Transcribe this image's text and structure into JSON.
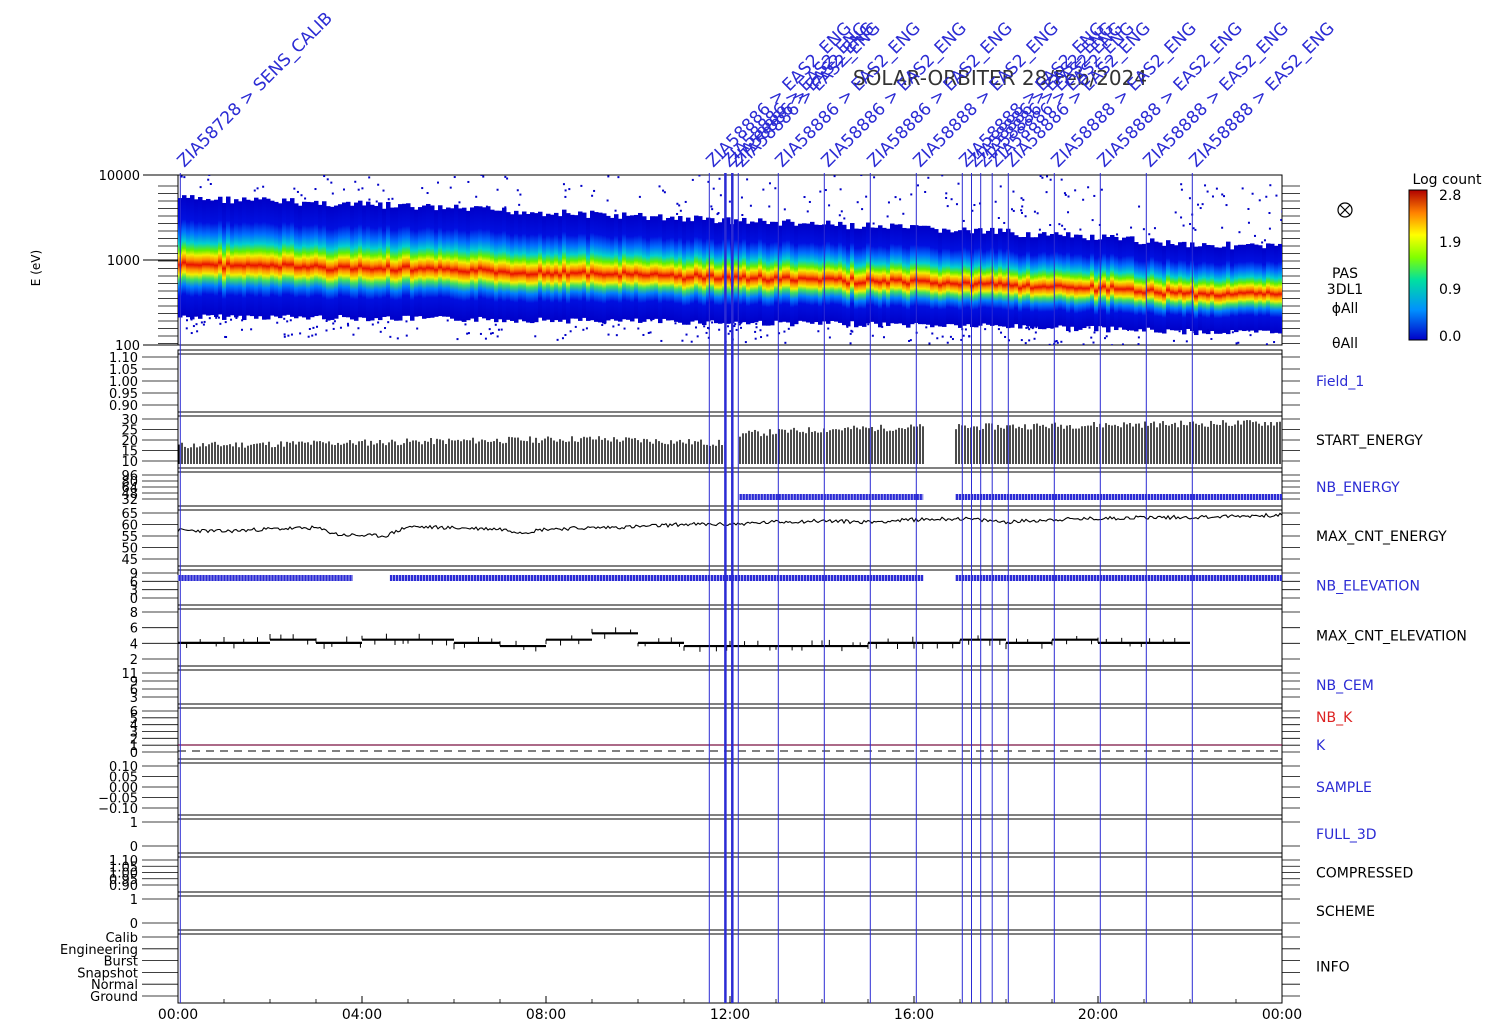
{
  "chart_data": {
    "type": "line",
    "title": "SOLAR-ORBITER 28/Feb/2024",
    "x_ticks": [
      "00:00",
      "04:00",
      "08:00",
      "12:00",
      "16:00",
      "20:00",
      "00:00"
    ],
    "x_range_hours": [
      0,
      24
    ],
    "colors": {
      "markers": "#2b2bd4",
      "black_series": "#000000",
      "nb_k": "#dd2222",
      "k_line": "#7a1040"
    },
    "markers": [
      {
        "hour": 0.05,
        "label": "ZIA58728 > SENS_CALIB"
      },
      {
        "hour": 11.55,
        "label": "ZIA58886 > EAS2_ENG"
      },
      {
        "hour": 11.9,
        "label": "ZIA58886 > EAS2_ENG"
      },
      {
        "hour": 12.05,
        "label": "ZIA58886 > EAS2_ENG"
      },
      {
        "hour": 12.18,
        "label": "ZIA58886 > EAS2_ENG"
      },
      {
        "hour": 13.05,
        "label": "ZIA58886 > EAS2_ENG"
      },
      {
        "hour": 14.05,
        "label": "ZIA58886 > EAS2_ENG"
      },
      {
        "hour": 15.05,
        "label": "ZIA58886 > EAS2_ENG"
      },
      {
        "hour": 16.05,
        "label": "ZIA58888 > EAS2_ENG"
      },
      {
        "hour": 17.05,
        "label": "ZIA58888 > EAS2_ENG"
      },
      {
        "hour": 17.25,
        "label": "ZIA58886 > EAS2_ENG"
      },
      {
        "hour": 17.45,
        "label": "ZIA58886 > EAS2_ENG"
      },
      {
        "hour": 17.7,
        "label": "ZIA58886 > EAS2_ENG"
      },
      {
        "hour": 18.05,
        "label": "ZIA58886 > EAS2_ENG"
      },
      {
        "hour": 19.05,
        "label": "ZIA58888 > EAS2_ENG"
      },
      {
        "hour": 20.05,
        "label": "ZIA58888 > EAS2_ENG"
      },
      {
        "hour": 21.05,
        "label": "ZIA58888 > EAS2_ENG"
      },
      {
        "hour": 22.05,
        "label": "ZIA58888 > EAS2_ENG"
      }
    ],
    "spectrogram": {
      "ylabel": "E (eV)",
      "y_ticks": [
        "10000",
        "1000",
        "100"
      ],
      "y_range": [
        100,
        10000
      ],
      "y_scale": "log",
      "side_labels": [
        "PAS",
        "3DL1",
        "ϕAll",
        "θAll"
      ],
      "colorbar": {
        "title": "Log count",
        "ticks": [
          "2.8",
          "1.9",
          "0.9",
          "0.0"
        ],
        "range": [
          0.0,
          2.8
        ]
      },
      "peak_energy_eV_by_hour": [
        [
          0,
          720
        ],
        [
          2,
          720
        ],
        [
          4,
          700
        ],
        [
          6,
          680
        ],
        [
          8,
          660
        ],
        [
          10,
          640
        ],
        [
          12,
          620
        ],
        [
          14,
          600
        ],
        [
          16,
          580
        ],
        [
          18,
          560
        ],
        [
          20,
          520
        ],
        [
          22,
          480
        ],
        [
          24,
          470
        ]
      ]
    },
    "panels": [
      {
        "name": "Field_1",
        "label_color": "#2b2bd4",
        "ticks": [
          "1.10",
          "1.05",
          "1.00",
          "0.95",
          "0.90"
        ],
        "kind": "empty"
      },
      {
        "name": "START_ENERGY",
        "label_color": "#000000",
        "ticks": [
          "30",
          "25",
          "20",
          "15",
          "10"
        ],
        "ylim": [
          10,
          30
        ],
        "kind": "bars",
        "series": [
          [
            0,
            18
          ],
          [
            3,
            19
          ],
          [
            6,
            20
          ],
          [
            9,
            21
          ],
          [
            11.9,
            19
          ],
          [
            12.2,
            23
          ],
          [
            14,
            25
          ],
          [
            16,
            26
          ],
          [
            17,
            26
          ],
          [
            20,
            27
          ],
          [
            24,
            28
          ]
        ],
        "gaps": [
          [
            11.9,
            12.2
          ],
          [
            16.2,
            16.9
          ]
        ]
      },
      {
        "name": "NB_ENERGY",
        "label_color": "#2b2bd4",
        "ticks": [
          "96",
          "80",
          "64",
          "48",
          "32"
        ],
        "kind": "blue_band",
        "band": [
          [
            12.2,
            16.2
          ],
          [
            16.9,
            24
          ]
        ]
      },
      {
        "name": "MAX_CNT_ENERGY",
        "label_color": "#000000",
        "ticks": [
          "65",
          "60",
          "55",
          "50",
          "45"
        ],
        "ylim": [
          43,
          67
        ],
        "kind": "line",
        "series": [
          [
            0,
            57.5
          ],
          [
            1,
            57
          ],
          [
            2,
            58
          ],
          [
            3,
            58.5
          ],
          [
            3.5,
            55.5
          ],
          [
            4.5,
            55
          ],
          [
            5,
            59
          ],
          [
            6,
            58.5
          ],
          [
            7,
            58
          ],
          [
            7.5,
            56.5
          ],
          [
            8,
            58
          ],
          [
            9,
            58.5
          ],
          [
            10,
            59
          ],
          [
            11,
            60
          ],
          [
            12,
            60
          ],
          [
            13,
            61
          ],
          [
            14,
            61.5
          ],
          [
            15,
            61
          ],
          [
            16,
            62
          ],
          [
            17,
            62.5
          ],
          [
            18,
            61
          ],
          [
            19,
            62
          ],
          [
            20,
            62.5
          ],
          [
            21,
            63
          ],
          [
            22,
            63
          ],
          [
            23,
            63.5
          ],
          [
            24,
            64
          ]
        ]
      },
      {
        "name": "NB_ELEVATION",
        "label_color": "#2b2bd4",
        "ticks": [
          "9",
          "6",
          "3",
          "0"
        ],
        "kind": "blue_band",
        "band": [
          [
            0,
            3.8
          ],
          [
            4.6,
            16.2
          ],
          [
            16.9,
            24
          ]
        ]
      },
      {
        "name": "MAX_CNT_ELEVATION",
        "label_color": "#000000",
        "ticks": [
          "8",
          "6",
          "4",
          "2"
        ],
        "ylim": [
          1,
          9
        ],
        "kind": "steps",
        "series": [
          [
            0,
            4
          ],
          [
            1,
            4
          ],
          [
            2,
            4.5
          ],
          [
            3,
            4
          ],
          [
            4,
            4.5
          ],
          [
            5,
            4.5
          ],
          [
            6,
            4
          ],
          [
            7,
            3.5
          ],
          [
            8,
            4.5
          ],
          [
            9,
            5.5
          ],
          [
            10,
            4
          ],
          [
            11,
            3.5
          ],
          [
            12,
            3.5
          ],
          [
            13,
            3.5
          ],
          [
            14,
            3.5
          ],
          [
            15,
            4
          ],
          [
            16,
            4
          ],
          [
            17,
            4.5
          ],
          [
            18,
            4
          ],
          [
            19,
            4.5
          ],
          [
            20,
            4
          ],
          [
            22,
            4.5
          ]
        ]
      },
      {
        "name": "NB_CEM",
        "label_color": "#2b2bd4",
        "ticks": [
          "11",
          "9",
          "6",
          "3"
        ],
        "kind": "empty"
      },
      {
        "name": "NB_K",
        "label_color": "#dd2222",
        "ticks": [
          "6",
          "5",
          "4",
          "3",
          "2",
          "1",
          "0"
        ],
        "kind": "k",
        "second_label": "K",
        "second_label_color": "#2b2bd4"
      },
      {
        "name": "SAMPLE",
        "label_color": "#2b2bd4",
        "ticks": [
          "0.10",
          "0.05",
          "0.00",
          "−0.05",
          "−0.10"
        ],
        "kind": "empty"
      },
      {
        "name": "FULL_3D",
        "label_color": "#2b2bd4",
        "ticks": [
          "1",
          "0"
        ],
        "kind": "empty"
      },
      {
        "name": "COMPRESSED",
        "label_color": "#000000",
        "ticks": [
          "1.10",
          "1.05",
          "1.00",
          "0.95",
          "0.90"
        ],
        "kind": "empty"
      },
      {
        "name": "SCHEME",
        "label_color": "#000000",
        "ticks": [
          "1",
          "0"
        ],
        "kind": "empty"
      },
      {
        "name": "INFO",
        "label_color": "#000000",
        "ticks": [
          "Calib",
          "Engineering",
          "Burst",
          "Snapshot",
          "Normal",
          "Ground"
        ],
        "kind": "empty"
      }
    ]
  }
}
